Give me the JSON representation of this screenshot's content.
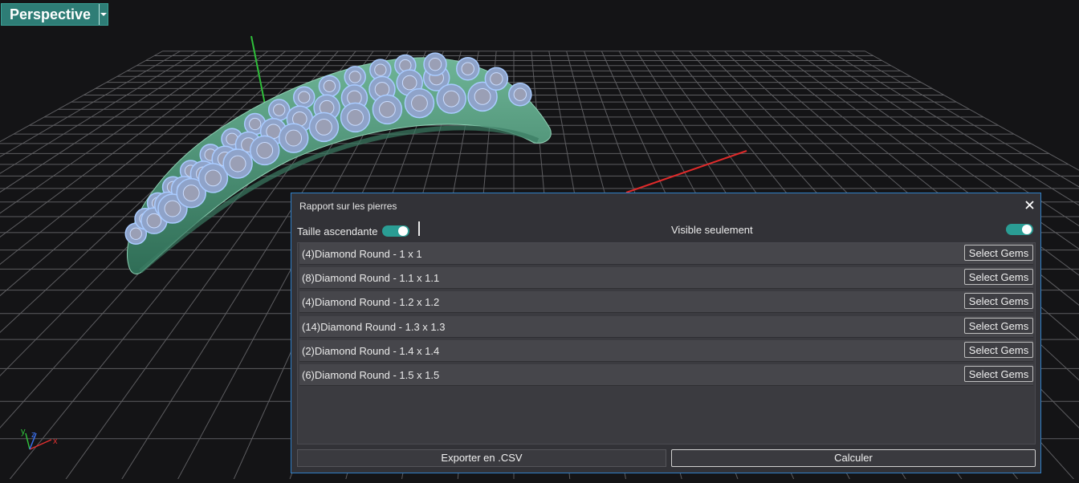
{
  "viewport": {
    "name": "Perspective",
    "axis_labels": {
      "x": "x",
      "y": "y",
      "z": "z"
    }
  },
  "dialog": {
    "title": "Rapport sur les pierres",
    "option_ascending": {
      "label": "Taille ascendante",
      "on": true
    },
    "option_visible": {
      "label": "Visible seulement",
      "on": true
    },
    "select_label": "Select Gems",
    "gems": [
      {
        "label": "(4)Diamond Round - 1 x 1"
      },
      {
        "label": "(8)Diamond Round - 1.1 x 1.1"
      },
      {
        "label": "(4)Diamond Round - 1.2 x 1.2"
      },
      {
        "label": "(14)Diamond Round - 1.3 x 1.3"
      },
      {
        "label": "(2)Diamond Round - 1.4 x 1.4"
      },
      {
        "label": "(6)Diamond Round - 1.5 x 1.5"
      }
    ],
    "export_label": "Exporter en .CSV",
    "calc_label": "Calculer"
  },
  "colors": {
    "accent": "#2e7d76",
    "toggle_on": "#2a9d94",
    "dialog_border": "#2f80c8",
    "ring_metal": "#4f9479",
    "gem": "#9ec3ff"
  }
}
